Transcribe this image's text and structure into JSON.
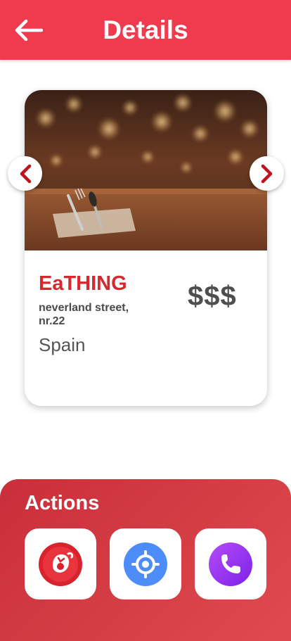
{
  "header": {
    "title": "Details",
    "back_icon": "arrow-left-icon"
  },
  "restaurant": {
    "name": "EaTHING",
    "address": "neverland street, nr.22",
    "country": "Spain",
    "price": "$$$"
  },
  "gallery": {
    "prev_icon": "chevron-left-icon",
    "next_icon": "chevron-right-icon"
  },
  "actions": {
    "title": "Actions",
    "items": [
      {
        "icon": "eatery-logo-icon"
      },
      {
        "icon": "location-target-icon"
      },
      {
        "icon": "phone-icon"
      }
    ]
  },
  "colors": {
    "brand_red": "#f03a4d",
    "name_red": "#d8282e",
    "chevron_red": "#c0121d",
    "panel_gradient_start": "#c92f3a",
    "panel_gradient_end": "#e04a4f",
    "location_blue": "#4d8dfb",
    "phone_purple": "#9b37f2"
  }
}
